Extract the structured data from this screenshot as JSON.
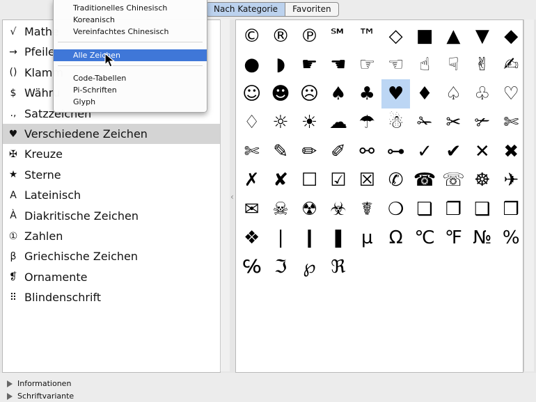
{
  "tabs": [
    {
      "label": "Nach Kategorie",
      "selected": true
    },
    {
      "label": "Favoriten",
      "selected": false
    }
  ],
  "popup_menu": {
    "group1": [
      "Traditionelles Chinesisch",
      "Koreanisch",
      "Vereinfachtes Chinesisch"
    ],
    "group2": [
      "Alle Zeichen"
    ],
    "group3": [
      "Code-Tabellen",
      "Pi-Schriften",
      "Glyph"
    ],
    "highlighted": "Alle Zeichen"
  },
  "categories": [
    {
      "icon": "√",
      "label": "Mathe"
    },
    {
      "icon": "→",
      "label": "Pfeile"
    },
    {
      "icon": "()",
      "label": "Klamm"
    },
    {
      "icon": "$",
      "label": "Währu"
    },
    {
      "icon": ".,",
      "label": "Satzzeichen"
    },
    {
      "icon": "♥",
      "label": "Verschiedene Zeichen",
      "selected": true
    },
    {
      "icon": "✠",
      "label": "Kreuze"
    },
    {
      "icon": "★",
      "label": "Sterne"
    },
    {
      "icon": "A",
      "label": "Lateinisch"
    },
    {
      "icon": "À",
      "label": "Diakritische Zeichen"
    },
    {
      "icon": "①",
      "label": "Zahlen"
    },
    {
      "icon": "β",
      "label": "Griechische Zeichen"
    },
    {
      "icon": "❡",
      "label": "Ornamente"
    },
    {
      "icon": "⠿",
      "label": "Blindenschrift"
    }
  ],
  "glyphs": [
    "©",
    "®",
    "℗",
    "℠",
    "™",
    "◇",
    "■",
    "▲",
    "▼",
    "◆",
    "●",
    "◗",
    "☛",
    "☚",
    "☞",
    "☜",
    "☝",
    "☟",
    "✌",
    "✍",
    "☺",
    "☻",
    "☹",
    "♠",
    "♣",
    "♥",
    "♦",
    "♤",
    "♧",
    "♡",
    "♢",
    "☼",
    "☀",
    "☁",
    "☂",
    "☃",
    "✁",
    "✂",
    "✃",
    "✄",
    "✄",
    "✎",
    "✏",
    "✐",
    "⚯",
    "⊶",
    "✓",
    "✔",
    "✕",
    "✖",
    "✗",
    "✘",
    "☐",
    "☑",
    "☒",
    "✆",
    "☎",
    "☏",
    "☸",
    "✈",
    "✉",
    "☠",
    "☢",
    "☣",
    "☤",
    "❍",
    "❏",
    "❐",
    "❑",
    "❒",
    "❖",
    "❘",
    "❙",
    "❚",
    "µ",
    "Ω",
    "℃",
    "℉",
    "№",
    "%",
    "℅",
    "ℑ",
    "℘",
    "ℜ"
  ],
  "selected_glyph": "♥",
  "footer": {
    "info": "Informationen",
    "variant": "Schriftvariante"
  }
}
